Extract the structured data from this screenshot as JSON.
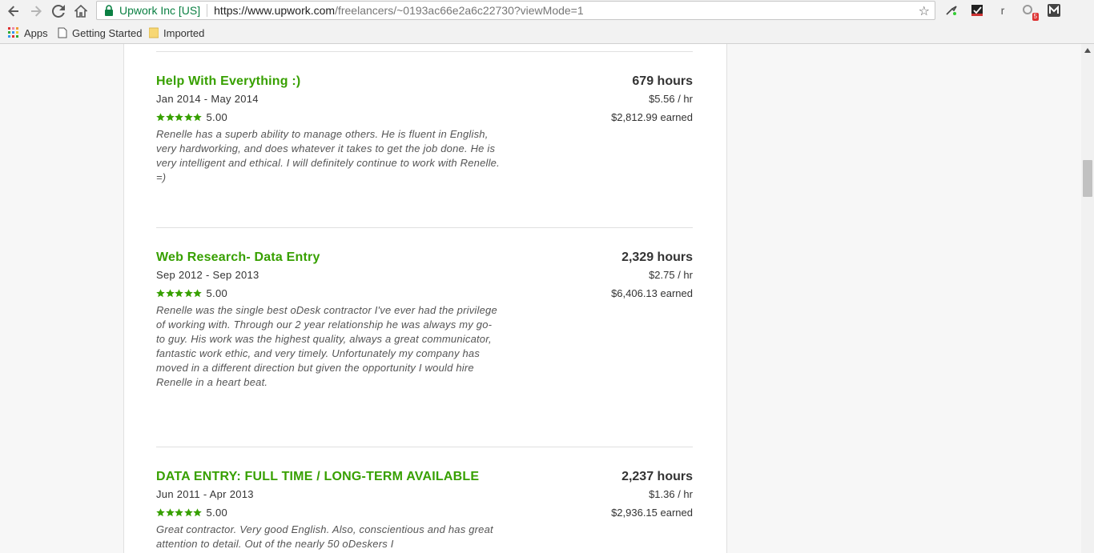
{
  "browser": {
    "site_identity": "Upwork Inc [US]",
    "url_main": "https://www.upwork.com",
    "url_path": "/freelancers/~0193ac66e2a6c22730?viewMode=1",
    "extension_badge": "5",
    "extension_letter": "r",
    "bookmarks": [
      {
        "label": "Apps"
      },
      {
        "label": "Getting Started"
      },
      {
        "label": "Imported"
      }
    ]
  },
  "jobs": [
    {
      "title": "Help With Everything :)",
      "dates": "Jan 2014 - May 2014",
      "rating": "5.00",
      "feedback": "Renelle has a superb ability to manage others. He is fluent in English, very hardworking, and does whatever it takes to get the job done. He is very intelligent and ethical. I will definitely continue to work with Renelle. =)",
      "hours": "679 hours",
      "rate": "$5.56 / hr",
      "earned": "$2,812.99 earned"
    },
    {
      "title": "Web Research- Data Entry",
      "dates": "Sep 2012 - Sep 2013",
      "rating": "5.00",
      "feedback": "Renelle was the single best oDesk contractor I've ever had the privilege of working with. Through our 2 year relationship he was always my go-to guy. His work was the highest quality, always a great communicator, fantastic work ethic, and very timely. Unfortunately my company has moved in a different direction but given the opportunity I would hire Renelle in a heart beat.",
      "hours": "2,329 hours",
      "rate": "$2.75 / hr",
      "earned": "$6,406.13 earned"
    },
    {
      "title": "DATA ENTRY: FULL TIME / LONG-TERM AVAILABLE",
      "dates": "Jun 2011 - Apr 2013",
      "rating": "5.00",
      "feedback": "Great contractor. Very good English. Also, conscientious and has great attention to detail. Out of the nearly 50 oDeskers I",
      "hours": "2,237 hours",
      "rate": "$1.36 / hr",
      "earned": "$2,936.15 earned"
    }
  ],
  "colors": {
    "accent": "#37a000",
    "star": "#37a000"
  }
}
